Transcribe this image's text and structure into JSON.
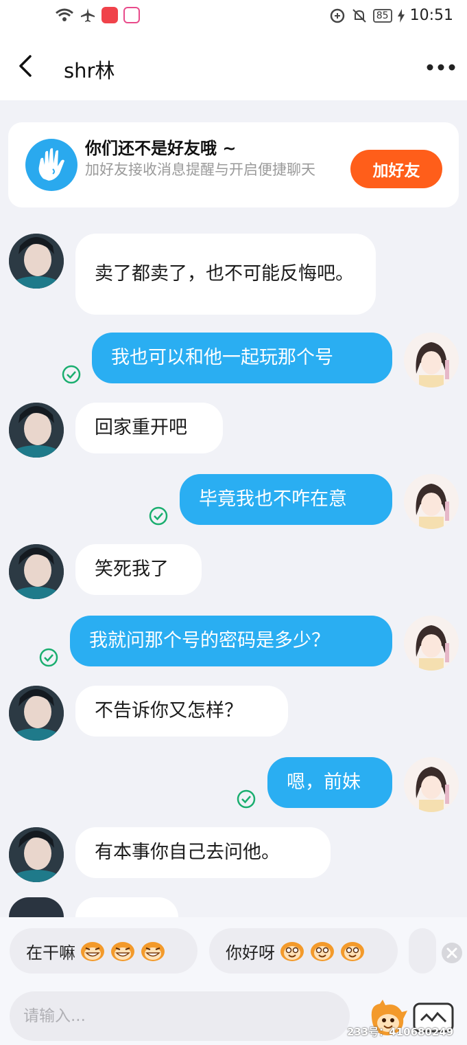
{
  "status_bar": {
    "time": "10:51",
    "battery": "85"
  },
  "nav": {
    "title": "shr林"
  },
  "friend_card": {
    "title": "你们还不是好友哦 ~",
    "subtitle": "加好友接收消息提醒与开启便捷聊天",
    "button": "加好友"
  },
  "messages": [
    {
      "side": "in",
      "text": "卖了都卖了，也不可能反悔吧。"
    },
    {
      "side": "out",
      "text": "我也可以和他一起玩那个号"
    },
    {
      "side": "in",
      "text": "回家重开吧"
    },
    {
      "side": "out",
      "text": "毕竟我也不咋在意"
    },
    {
      "side": "in",
      "text": "笑死我了"
    },
    {
      "side": "out",
      "text": "我就问那个号的密码是多少？"
    },
    {
      "side": "in",
      "text": "不告诉你又怎样？"
    },
    {
      "side": "out",
      "text": "嗯，前妹"
    },
    {
      "side": "in",
      "text": "有本事你自己去问他。"
    }
  ],
  "quick_replies": [
    {
      "label": "在干嘛"
    },
    {
      "label": "你好呀"
    }
  ],
  "input": {
    "placeholder": "请输入..."
  },
  "watermark": "233号：410680249",
  "colors": {
    "accent": "#2aaef2",
    "add_button": "#ff5e1a",
    "check": "#1aae6f"
  }
}
